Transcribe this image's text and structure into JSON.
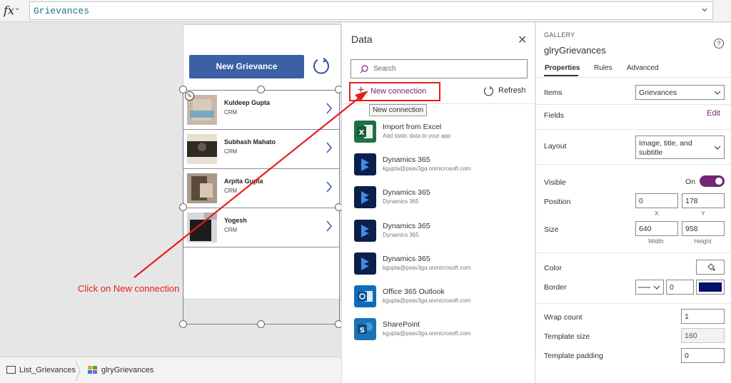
{
  "formula_bar": {
    "fx_label": "fx",
    "value": "Grievances"
  },
  "canvas": {
    "new_grievance_label": "New Grievance",
    "gallery_items": [
      {
        "title": "Kuldeep Gupta",
        "subtitle": "CRM"
      },
      {
        "title": "Subhash Mahato",
        "subtitle": "CRM"
      },
      {
        "title": "Arpita Gupta",
        "subtitle": "CRM"
      },
      {
        "title": "Yogesh",
        "subtitle": "CRM"
      }
    ],
    "annotation": "Click on New connection"
  },
  "data_panel": {
    "title": "Data",
    "search_placeholder": "Search",
    "new_connection_label": "New connection",
    "refresh_label": "Refresh",
    "tooltip": "New connection",
    "sources": [
      {
        "title": "Import from Excel",
        "subtitle": "Add static data to your app",
        "icon": "excel-icon",
        "color": "#1e7145"
      },
      {
        "title": "Dynamics 365",
        "subtitle": "kgupta@psav3ga.onmicrosoft.com",
        "icon": "dynamics-365-icon",
        "color": "#0b1f4b"
      },
      {
        "title": "Dynamics 365",
        "subtitle": "Dynamics 365",
        "icon": "dynamics-365-icon",
        "color": "#0b1f4b"
      },
      {
        "title": "Dynamics 365",
        "subtitle": "Dynamics 365",
        "icon": "dynamics-365-icon",
        "color": "#0b1f4b"
      },
      {
        "title": "Dynamics 365",
        "subtitle": "kgupta@psav3ga.onmicrosoft.com",
        "icon": "dynamics-365-icon",
        "color": "#0b1f4b"
      },
      {
        "title": "Office 365 Outlook",
        "subtitle": "kgupta@psav3ga.onmicrosoft.com",
        "icon": "outlook-icon",
        "color": "#0f6cbd"
      },
      {
        "title": "SharePoint",
        "subtitle": "kgupta@psav3ga.onmicrosoft.com",
        "icon": "sharepoint-icon",
        "color": "#1a73b5"
      }
    ]
  },
  "properties": {
    "category": "GALLERY",
    "control_name": "glryGrievances",
    "tabs": [
      "Properties",
      "Rules",
      "Advanced"
    ],
    "items_label": "Items",
    "items_value": "Grievances",
    "fields_label": "Fields",
    "fields_edit": "Edit",
    "layout_label": "Layout",
    "layout_value": "Image, title, and subtitle",
    "visible_label": "Visible",
    "visible_value": "On",
    "position_label": "Position",
    "position_x": "0",
    "position_y": "178",
    "x_caption": "X",
    "y_caption": "Y",
    "size_label": "Size",
    "size_width": "640",
    "size_height": "958",
    "width_caption": "Width",
    "height_caption": "Height",
    "color_label": "Color",
    "border_label": "Border",
    "border_width": "0",
    "border_color": "#00106b",
    "wrap_count_label": "Wrap count",
    "wrap_count": "1",
    "template_size_label": "Template size",
    "template_size": "160",
    "template_padding_label": "Template padding",
    "template_padding": "0"
  },
  "status_bar": {
    "screen_name": "List_Grievances",
    "control_name": "glryGrievances"
  },
  "colors": {
    "accent": "#742774",
    "button_blue": "#3c5fa6",
    "annotation_red": "#e81c1c"
  }
}
